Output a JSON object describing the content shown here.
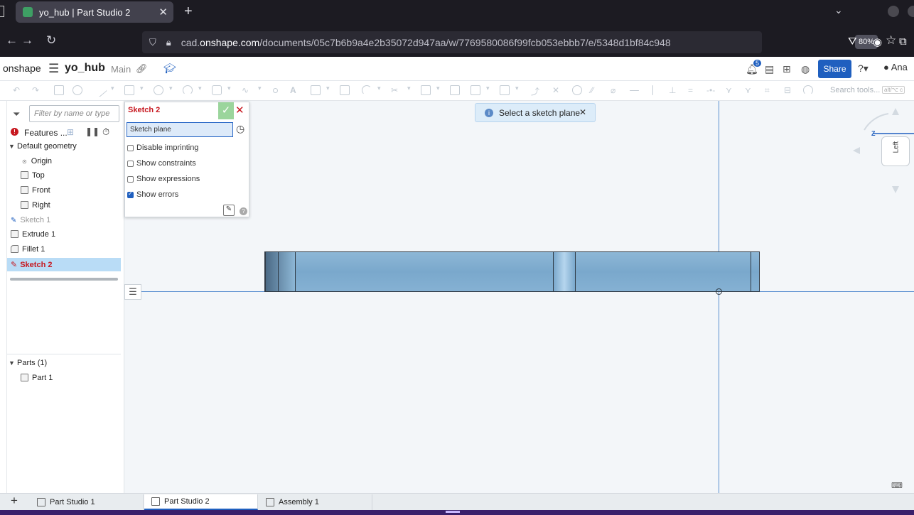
{
  "browser": {
    "tab_title": "yo_hub | Part Studio 2",
    "url_prefix": "cad.",
    "url_domain": "onshape.com",
    "url_path": "/documents/05c7b6b9a4e2b35072d947aa/w/7769580086f99fcb053ebbb7/e/5348d1bf84c948",
    "zoom": "80%"
  },
  "header": {
    "logo": "onshape",
    "doc_name": "yo_hub",
    "branch": "Main",
    "notifications": "5",
    "share": "Share",
    "user": "Ana"
  },
  "toolbar": {
    "search_placeholder": "Search tools...",
    "search_shortcut": "alt/⌥ c"
  },
  "feature_panel": {
    "filter_placeholder": "Filter by name or type",
    "features_label": "Features ...",
    "default_geometry": "Default geometry",
    "items": [
      "Origin",
      "Top",
      "Front",
      "Right"
    ],
    "features": [
      "Sketch 1",
      "Extrude 1",
      "Fillet 1",
      "Sketch 2"
    ],
    "parts_header": "Parts (1)",
    "parts": [
      "Part 1"
    ]
  },
  "sketch_dialog": {
    "title": "Sketch 2",
    "plane_field": "Sketch plane",
    "options": [
      {
        "label": "Disable imprinting",
        "checked": false
      },
      {
        "label": "Show constraints",
        "checked": false
      },
      {
        "label": "Show expressions",
        "checked": false
      },
      {
        "label": "Show errors",
        "checked": true
      }
    ]
  },
  "toast": {
    "message": "Select a sketch plane"
  },
  "viewcube": {
    "face": "Left",
    "axis_z": "Z"
  },
  "bottom_tabs": [
    "Part Studio 1",
    "Part Studio 2",
    "Assembly 1"
  ]
}
